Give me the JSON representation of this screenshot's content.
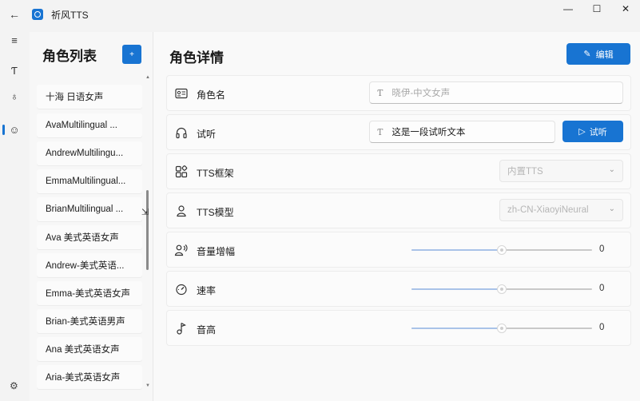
{
  "window": {
    "title": "祈风TTS",
    "back_icon": "back-arrow-icon",
    "minimize": "—",
    "maximize": "☐",
    "close": "✕"
  },
  "nav": {
    "items": [
      {
        "icon": "menu-icon",
        "glyph": "≡"
      },
      {
        "icon": "text-icon",
        "glyph": "Ƭ"
      },
      {
        "icon": "chat-icon",
        "glyph": "♁"
      },
      {
        "icon": "person-icon",
        "glyph": "☺"
      }
    ],
    "settings_glyph": "⚙"
  },
  "role_list": {
    "title": "角色列表",
    "add_glyph": "+",
    "items": [
      "十海 日语女声",
      "AvaMultilingual ...",
      "AndrewMultilingu...",
      "EmmaMultilingual...",
      "BrianMultilingual ...",
      "Ava 美式英语女声",
      "Andrew-美式英语...",
      "Emma-美式英语女声",
      "Brian-美式英语男声",
      "Ana 美式英语女声",
      "Aria-美式英语女声"
    ]
  },
  "detail": {
    "title": "角色详情",
    "edit_label": "编辑",
    "name_row": {
      "label": "角色名",
      "placeholder": "晓伊-中文女声"
    },
    "audition_row": {
      "label": "试听",
      "value": "这是一段试听文本",
      "button": "试听"
    },
    "framework_row": {
      "label": "TTS框架",
      "value": "内置TTS"
    },
    "model_row": {
      "label": "TTS模型",
      "value": "zh-CN-XiaoyiNeural"
    },
    "volume_row": {
      "label": "音量增幅",
      "value": "0",
      "level": 0.5
    },
    "rate_row": {
      "label": "速率",
      "value": "0",
      "level": 0.5
    },
    "pitch_row": {
      "label": "音高",
      "value": "0",
      "level": 0.5
    }
  },
  "colors": {
    "accent": "#1874d2"
  }
}
